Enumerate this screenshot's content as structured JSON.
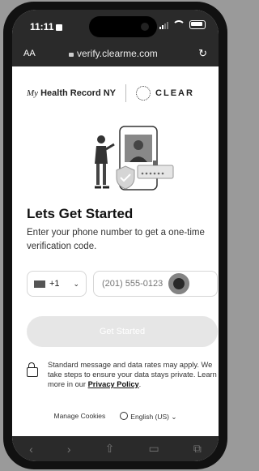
{
  "status": {
    "time": "11:11"
  },
  "browser": {
    "text_size": "AA",
    "url": "verify.clearme.com"
  },
  "logos": {
    "hr_script": "My",
    "hr_text": "Health Record NY",
    "clear": "CLEAR"
  },
  "page": {
    "title": "Lets Get Started",
    "subtitle": "Enter your phone number to get a one-time verification code.",
    "country_code": "+1",
    "phone_placeholder": "(201) 555-0123",
    "cta": "Get Started",
    "notice_text": "Standard message and data rates may apply. We take steps to ensure your data stays private. Learn more in our ",
    "privacy_link": "Privacy Policy",
    "notice_end": "."
  },
  "footer": {
    "manage_cookies": "Manage Cookies",
    "language": "English (US)"
  },
  "toolbar": [
    "back-icon",
    "forward-icon",
    "share-icon",
    "bookmarks-icon",
    "tabs-icon"
  ]
}
